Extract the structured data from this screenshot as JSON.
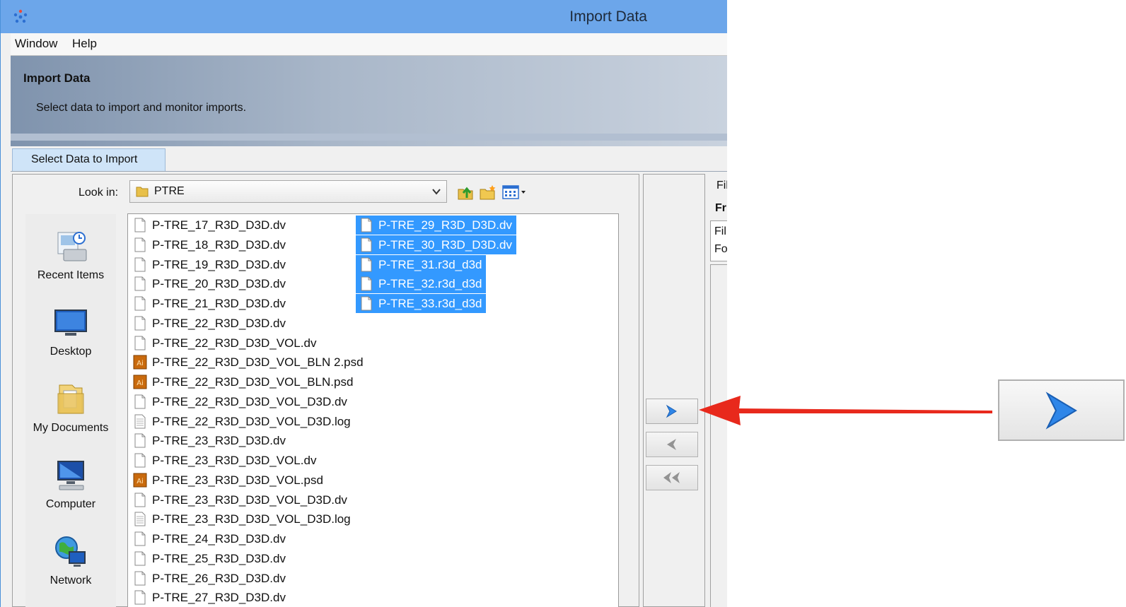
{
  "window": {
    "title": "Import Data",
    "accent_color": "#6ca6ea",
    "icon": "app-logo-icon"
  },
  "menubar": {
    "items": [
      {
        "label": "Window"
      },
      {
        "label": "Help"
      }
    ]
  },
  "header": {
    "title": "Import Data",
    "subtitle": "Select data to import and monitor imports."
  },
  "tabs": [
    {
      "label": "Select Data to Import",
      "active": true
    }
  ],
  "chooser": {
    "look_in_label": "Look in:",
    "look_in_value": "PTRE",
    "toolbar_icons": [
      "up-folder-icon",
      "new-folder-icon",
      "view-menu-icon"
    ],
    "places": [
      {
        "label": "Recent Items",
        "icon": "recent-items-icon"
      },
      {
        "label": "Desktop",
        "icon": "desktop-icon"
      },
      {
        "label": "My Documents",
        "icon": "my-documents-icon"
      },
      {
        "label": "Computer",
        "icon": "computer-icon"
      },
      {
        "label": "Network",
        "icon": "network-icon"
      }
    ],
    "files_col1": [
      {
        "name": "P-TRE_17_R3D_D3D.dv",
        "type": "file"
      },
      {
        "name": "P-TRE_18_R3D_D3D.dv",
        "type": "file"
      },
      {
        "name": "P-TRE_19_R3D_D3D.dv",
        "type": "file"
      },
      {
        "name": "P-TRE_20_R3D_D3D.dv",
        "type": "file"
      },
      {
        "name": "P-TRE_21_R3D_D3D.dv",
        "type": "file"
      },
      {
        "name": "P-TRE_22_R3D_D3D.dv",
        "type": "file"
      },
      {
        "name": "P-TRE_22_R3D_D3D_VOL.dv",
        "type": "file"
      },
      {
        "name": "P-TRE_22_R3D_D3D_VOL_BLN 2.psd",
        "type": "ai"
      },
      {
        "name": "P-TRE_22_R3D_D3D_VOL_BLN.psd",
        "type": "ai"
      },
      {
        "name": "P-TRE_22_R3D_D3D_VOL_D3D.dv",
        "type": "file"
      },
      {
        "name": "P-TRE_22_R3D_D3D_VOL_D3D.log",
        "type": "log"
      },
      {
        "name": "P-TRE_23_R3D_D3D.dv",
        "type": "file"
      },
      {
        "name": "P-TRE_23_R3D_D3D_VOL.dv",
        "type": "file"
      },
      {
        "name": "P-TRE_23_R3D_D3D_VOL.psd",
        "type": "ai"
      },
      {
        "name": "P-TRE_23_R3D_D3D_VOL_D3D.dv",
        "type": "file"
      },
      {
        "name": "P-TRE_23_R3D_D3D_VOL_D3D.log",
        "type": "log"
      },
      {
        "name": "P-TRE_24_R3D_D3D.dv",
        "type": "file"
      },
      {
        "name": "P-TRE_25_R3D_D3D.dv",
        "type": "file"
      },
      {
        "name": "P-TRE_26_R3D_D3D.dv",
        "type": "file"
      },
      {
        "name": "P-TRE_27_R3D_D3D.dv",
        "type": "file"
      }
    ],
    "files_col2": [
      {
        "name": "P-TRE_29_R3D_D3D.dv",
        "type": "file",
        "selected": true
      },
      {
        "name": "P-TRE_30_R3D_D3D.dv",
        "type": "file",
        "selected": true
      },
      {
        "name": "P-TRE_31.r3d_d3d",
        "type": "file",
        "selected": true
      },
      {
        "name": "P-TRE_32.r3d_d3d",
        "type": "file",
        "selected": true
      },
      {
        "name": "P-TRE_33.r3d_d3d",
        "type": "file",
        "selected": true
      }
    ],
    "selection_color": "#3399ff"
  },
  "transfer_buttons": [
    {
      "icon": "chevron-right-icon",
      "action": "add"
    },
    {
      "icon": "chevron-left-icon",
      "action": "remove"
    },
    {
      "icon": "double-chevron-left-icon",
      "action": "remove-all"
    }
  ],
  "right_panel": {
    "texts": [
      "Fil",
      "Fr",
      "Fil",
      "Fo"
    ]
  },
  "annotation": {
    "arrow_color": "#e8291c",
    "zoom_icon": "chevron-right-icon"
  }
}
